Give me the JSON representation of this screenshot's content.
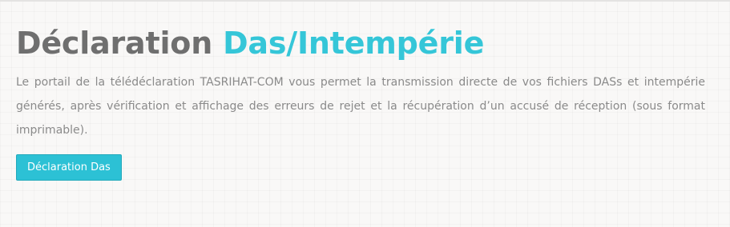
{
  "hero": {
    "title_prefix": "Déclaration",
    "title_accent": "Das/Intempérie",
    "description": "Le portail de la télédéclaration TASRIHAT-COM vous permet la transmission directe de vos fichiers DASs et intempérie générés, après vérification et affichage des erreurs de rejet et la récupération d’un accusé de réception (sous format imprimable).",
    "button_label": "Déclaration Das"
  },
  "colors": {
    "accent": "#35c6d8",
    "title_gray": "#6f6f6f",
    "text_gray": "#8a8a8a",
    "button_bg": "#2cc1d5"
  }
}
